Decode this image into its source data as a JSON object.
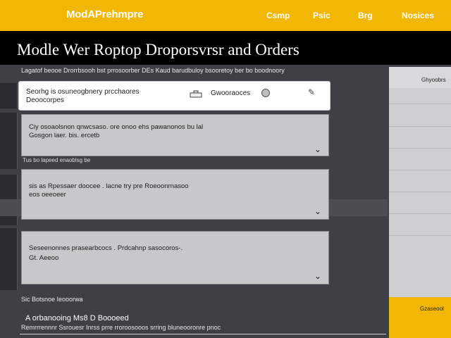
{
  "header": {
    "brand": "ModAPrehmpre",
    "nav": [
      "Csmp",
      "Psic",
      "Brg",
      "Nosices"
    ]
  },
  "title": {
    "page_title": "Modle Wer Roptop Droporsvrsr and Orders",
    "subheading": "Lagatof beooe Drorrbsooh bst prrosoorber DEs Kaud barudbuloy bsooretoy ber bo boodnoory"
  },
  "search": {
    "placeholder_line1": "Seorhg is osuneogbnery prcchaores",
    "placeholder_line2": "Deoocorpes",
    "filter_label": "Gwooraoces"
  },
  "cards": [
    {
      "line1": "Ciy osoaolsnon qnwcsaso. ore onoo ehs pawanonos bu lal",
      "line2": "Gosgon laer. bis. ercetb"
    },
    {
      "line1": "sis  as Rpessaer doocee . lacne try pre Roeoonrnasoo",
      "line2": "eos oeeoeer"
    },
    {
      "line1": "Seseenonnes prasearbcocs . Prdcahnp sasocoros-.",
      "line2": "Gt. Aeeoo"
    }
  ],
  "gap_labels": [
    "Tus bo lapeed enaoblsg be",
    "Sic Botsnoe Ieooorwa"
  ],
  "side": {
    "title": "Ghyoobrs",
    "footer_label": "Gzaseool"
  },
  "bottom": {
    "item1": "A  orbanooing Ms8 D  Boooeed",
    "item2": "Remrrrennnr Ssrouesr  Inrss prre rroroosooos srring bluneooronre pnoc"
  },
  "colors": {
    "accent": "#f2b705",
    "background": "#3f4045",
    "card": "#c8c8ca"
  },
  "icons": [
    "tool-icon",
    "dot-icon",
    "pencil-icon",
    "chevron-down-icon"
  ]
}
